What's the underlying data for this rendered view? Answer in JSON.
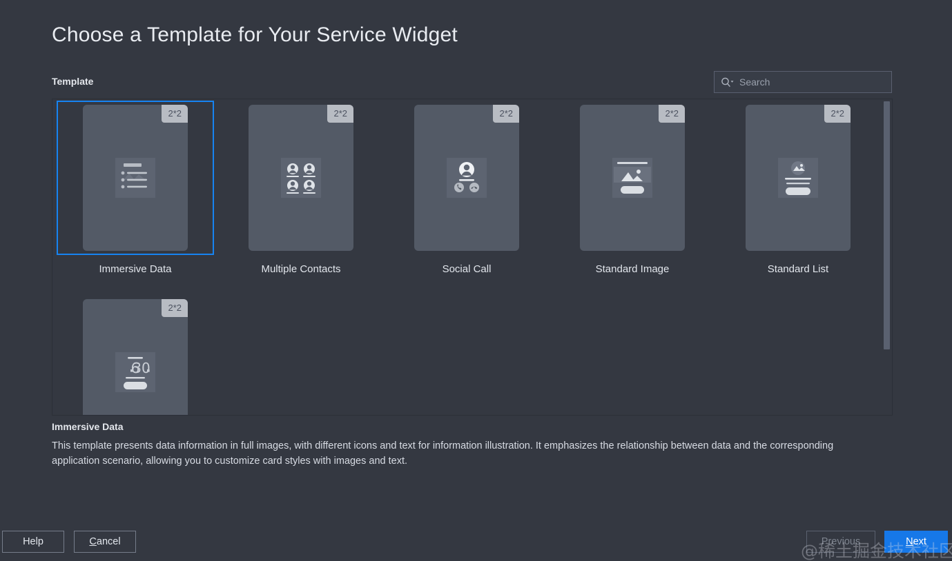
{
  "header": {
    "title": "Choose a Template for Your Service Widget"
  },
  "section": {
    "label": "Template"
  },
  "search": {
    "placeholder": "Search",
    "value": "",
    "icon": "search-dropdown-icon"
  },
  "templates": [
    {
      "name": "Immersive Data",
      "size_badge": "2*2",
      "glyph": "list-with-image-icon",
      "selected": true
    },
    {
      "name": "Multiple Contacts",
      "size_badge": "2*2",
      "glyph": "four-avatars-icon",
      "selected": false
    },
    {
      "name": "Social Call",
      "size_badge": "2*2",
      "glyph": "avatar-call-buttons-icon",
      "selected": false
    },
    {
      "name": "Standard Image",
      "size_badge": "2*2",
      "glyph": "image-card-button-icon",
      "selected": false
    },
    {
      "name": "Standard List",
      "size_badge": "2*2",
      "glyph": "image-lines-button-icon",
      "selected": false
    },
    {
      "name": "",
      "size_badge": "2*2",
      "glyph": "clock-6-30-icon",
      "selected": false
    }
  ],
  "description": {
    "title": "Immersive Data",
    "body": "This template presents data information in full images, with different icons and text for information illustration. It emphasizes the relationship between data and the corresponding application scenario, allowing you to customize card styles with images and text."
  },
  "footer": {
    "help": "Help",
    "cancel_mnemonic": "C",
    "cancel_rest": "ancel",
    "previous": "Previous",
    "next_mnemonic": "N",
    "next_rest": "ext"
  },
  "watermark": {
    "text": "@稀土掘金技术社区"
  },
  "colors": {
    "background": "#343841",
    "thumb_card": "#535a66",
    "accent_blue": "#1684f2",
    "primary_button": "#1678e8",
    "badge": "#b8bcc3"
  }
}
